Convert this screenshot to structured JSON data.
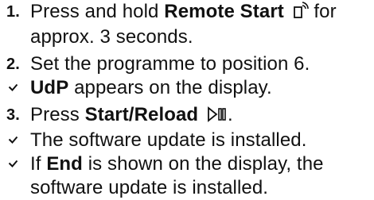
{
  "steps": [
    {
      "marker": "1.",
      "before": "Press and hold ",
      "bold": "Remote Start",
      "after": " for approx. 3 seconds.",
      "icon": "remote-start-icon"
    },
    {
      "marker": "2.",
      "text": "Set the programme to position 6."
    },
    {
      "marker": "check",
      "bold": "UdP",
      "after": " appears on the display."
    },
    {
      "marker": "3.",
      "before": "Press ",
      "bold": "Start/Reload",
      "after": ".",
      "icon": "start-pause-icon"
    },
    {
      "marker": "check",
      "text": "The software update is installed."
    },
    {
      "marker": "check",
      "before": "If ",
      "bold": "End",
      "after": " is shown on the display, the software update is installed."
    }
  ]
}
